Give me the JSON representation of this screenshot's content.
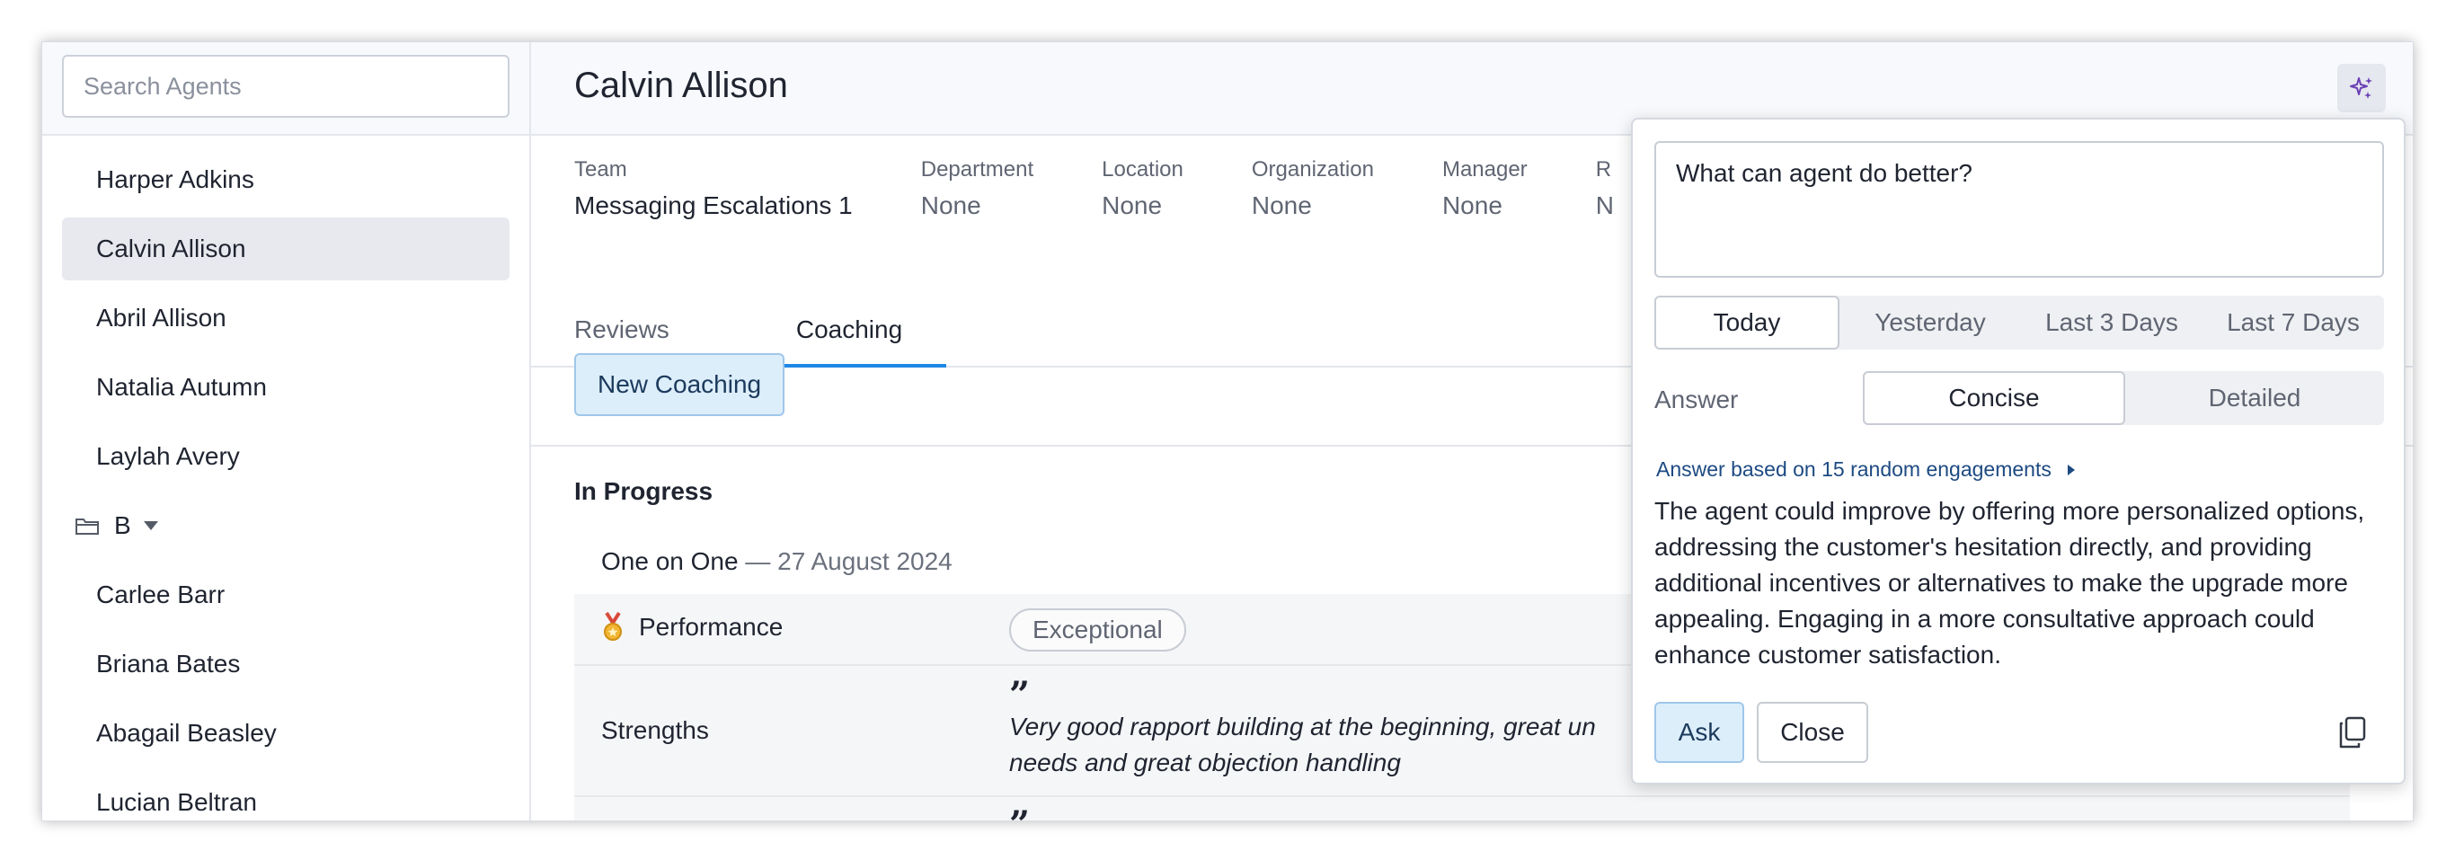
{
  "sidebar": {
    "search_placeholder": "Search Agents",
    "agents_top": [
      {
        "name": "Harper Adkins",
        "selected": false
      },
      {
        "name": "Calvin Allison",
        "selected": true
      },
      {
        "name": "Abril Allison",
        "selected": false
      },
      {
        "name": "Natalia Autumn",
        "selected": false
      },
      {
        "name": "Laylah Avery",
        "selected": false
      }
    ],
    "group_label": "B",
    "agents_group": [
      "Carlee Barr",
      "Briana Bates",
      "Abagail Beasley",
      "Lucian Beltran"
    ]
  },
  "main": {
    "agent_name": "Calvin Allison",
    "info": [
      {
        "label": "Team",
        "value": "Messaging Escalations 1"
      },
      {
        "label": "Department",
        "value": "None"
      },
      {
        "label": "Location",
        "value": "None"
      },
      {
        "label": "Organization",
        "value": "None"
      },
      {
        "label": "Manager",
        "value": "None"
      },
      {
        "label": "R",
        "value": "N"
      }
    ],
    "tabs": [
      {
        "label": "Reviews",
        "active": false
      },
      {
        "label": "Coaching",
        "active": true
      }
    ],
    "new_coaching_label": "New Coaching",
    "section_title": "In Progress",
    "session": {
      "name": "One on One",
      "date": " — 27 August 2024"
    },
    "rows": {
      "performance_label": "Performance",
      "performance_value": "Exceptional",
      "strengths_label": "Strengths",
      "strengths_text": "Very good rapport building at the beginning, great un needs and great objection handling"
    }
  },
  "popover": {
    "question": "What can agent do better?",
    "ranges": [
      {
        "label": "Today",
        "active": true
      },
      {
        "label": "Yesterday",
        "active": false
      },
      {
        "label": "Last 3 Days",
        "active": false
      },
      {
        "label": "Last 7 Days",
        "active": false
      }
    ],
    "answer_label": "Answer",
    "answer_modes": [
      {
        "label": "Concise",
        "active": true
      },
      {
        "label": "Detailed",
        "active": false
      }
    ],
    "based_on": "Answer based on 15 random engagements",
    "answer_text": "The agent could improve by offering more personalized options, addressing the customer's hesitation directly, and providing additional incentives or alternatives to make the upgrade more appealing. Engaging in a more consultative approach could enhance customer satisfaction.",
    "ask_label": "Ask",
    "close_label": "Close"
  },
  "colors": {
    "accent": "#1e88e5",
    "button_bg": "#ddeefb",
    "ai_icon": "#6a3fb5"
  },
  "icons": [
    "folder-icon",
    "caret-down-icon",
    "sparkles-icon",
    "medal-icon",
    "copy-icon",
    "play-icon"
  ]
}
